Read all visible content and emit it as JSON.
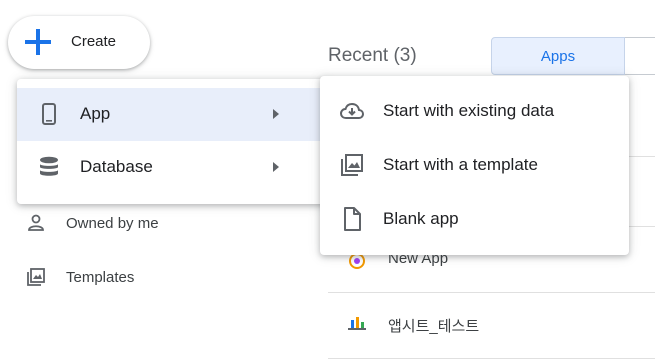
{
  "create_button": {
    "label": "Create"
  },
  "main": {
    "recent_title": "Recent (3)",
    "tabs": [
      {
        "label": "Apps"
      }
    ],
    "list_items": [
      {
        "name": "New App"
      },
      {
        "name": "앱시트_테스트"
      }
    ]
  },
  "sidebar": {
    "items": [
      {
        "label": "Owned by me",
        "icon": "person-icon"
      },
      {
        "label": "Templates",
        "icon": "templates-icon"
      }
    ]
  },
  "create_menu": {
    "items": [
      {
        "label": "App",
        "icon": "smartphone-icon",
        "active": true
      },
      {
        "label": "Database",
        "icon": "database-icon",
        "active": false
      }
    ]
  },
  "app_submenu": {
    "items": [
      {
        "label": "Start with existing data",
        "icon": "cloud-download-icon"
      },
      {
        "label": "Start with a template",
        "icon": "template-icon"
      },
      {
        "label": "Blank app",
        "icon": "blank-file-icon"
      }
    ]
  },
  "colors": {
    "accent": "#1a73e8",
    "active_bg": "#e8eefa",
    "icon_gray": "#5f6368"
  }
}
